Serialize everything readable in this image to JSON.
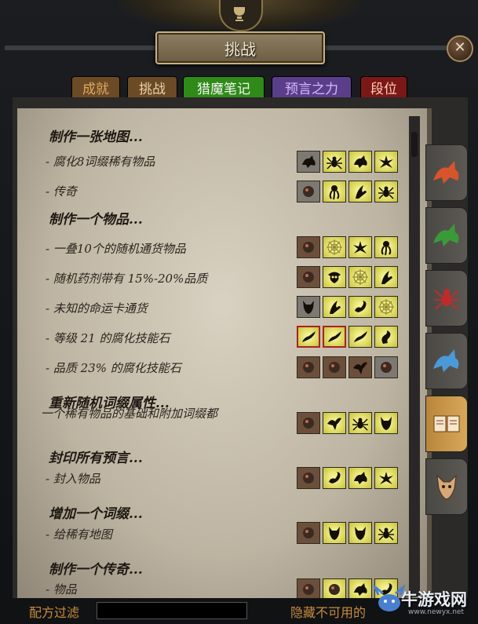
{
  "title": "挑战",
  "close_icon": "close-icon",
  "tabs": [
    {
      "label": "成就",
      "color": "#e0a860"
    },
    {
      "label": "挑战",
      "color": "#ead3a8"
    },
    {
      "label": "猎魔笔记",
      "color": "#2f8a18",
      "active": true
    },
    {
      "label": "预言之力",
      "color": "#d7b8ff"
    },
    {
      "label": "段位",
      "color": "#ffd0b0"
    }
  ],
  "sections": [
    {
      "header": "制作一张地图...",
      "items": [
        {
          "label": "- 腐化8词缀稀有物品",
          "icons": [
            "wolf",
            "spider",
            "beast",
            "insect"
          ]
        },
        {
          "label": "- 传奇",
          "icons": [
            "hand",
            "tentacle",
            "claw",
            "spider"
          ]
        }
      ]
    },
    {
      "header": "制作一个物品...",
      "items": [
        {
          "label": "- 一叠10个的随机通货物品",
          "icons": [
            "creature",
            "web",
            "insect",
            "tentacle"
          ]
        },
        {
          "label": "- 随机药剂带有 15%-20%品质",
          "icons": [
            "cat",
            "skull",
            "web",
            "claw"
          ]
        },
        {
          "label": "- 未知的命运卡通货",
          "icons": [
            "demon",
            "claw",
            "scorpion",
            "web"
          ]
        },
        {
          "label": "- 等级 21 的腐化技能石",
          "icons": [
            "leech",
            "leech",
            "leech",
            "hook"
          ]
        },
        {
          "label": "- 品质 23% 的腐化技能石",
          "icons": [
            "warrior",
            "ogre",
            "bird",
            "ghost"
          ]
        }
      ]
    },
    {
      "header": "重新随机词缀属性...",
      "items": [
        {
          "label": "一个稀有物品的基础和附加词缀都",
          "icons": [
            "pirate",
            "bird",
            "spider",
            "demon"
          ]
        }
      ]
    },
    {
      "header": "封印所有预言...",
      "items": [
        {
          "label": "- 封入物品",
          "icons": [
            "harpy",
            "scorpion",
            "wolf",
            "insect"
          ]
        }
      ]
    },
    {
      "header": "增加一个词缀...",
      "items": [
        {
          "label": "- 给稀有地图",
          "icons": [
            "lizard",
            "demon",
            "mask",
            "spider"
          ]
        }
      ]
    },
    {
      "header": "制作一个传奇...",
      "items": [
        {
          "label": "- 物品",
          "icons": [
            "ghost",
            "bug",
            "beast",
            "scorpion"
          ]
        }
      ]
    }
  ],
  "side_tabs": [
    "red-dragon-icon",
    "green-serpent-icon",
    "spider-icon",
    "blue-wraith-icon",
    "book-icon",
    "skull-mask-icon"
  ],
  "footer": {
    "filter_label": "配方过滤",
    "hide_label": "隐藏不可用的"
  },
  "watermark": {
    "text": "牛游戏网",
    "url": "www.newyx.net"
  }
}
